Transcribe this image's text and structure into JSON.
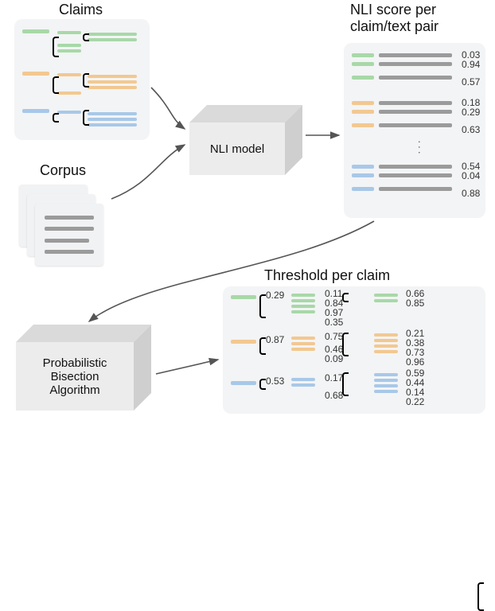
{
  "labels": {
    "claims": "Claims",
    "corpus": "Corpus",
    "nli_model": "NLI model",
    "nli_score_title": "NLI score per\nclaim/text pair",
    "pba": "Probabilistic\nBisection\nAlgorithm",
    "threshold_title": "Threshold per claim"
  },
  "palette": {
    "green": "#a8d8a8",
    "orange": "#f2c891",
    "blue": "#a8c8e8",
    "grey": "#9b9b9b",
    "panel": "#f3f4f5"
  },
  "nli_scores": {
    "green": [
      "0.03",
      "0.94",
      "0.57"
    ],
    "orange": [
      "0.18",
      "0.29",
      "0.63"
    ],
    "blue": [
      "0.54",
      "0.04",
      "0.88"
    ]
  },
  "thresholds": {
    "green": {
      "root": "0.29",
      "mid": [
        "0.11",
        "0.84",
        "0.97",
        "0.35"
      ],
      "leaf": [
        "0.66",
        "0.85"
      ]
    },
    "orange": {
      "root": "0.87",
      "mid": [
        "0.75",
        "0.46",
        "0.09"
      ],
      "leaf": [
        "0.21",
        "0.38",
        "0.73",
        "0.96"
      ]
    },
    "blue": {
      "root": "0.53",
      "mid": [
        "0.17",
        "0.68"
      ],
      "leaf": [
        "0.59",
        "0.44",
        "0.14",
        "0.22"
      ]
    }
  }
}
